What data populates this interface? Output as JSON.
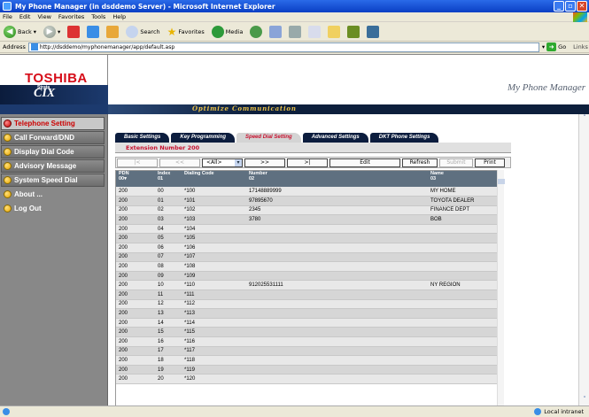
{
  "window": {
    "title": "My Phone Manager (in dsddemo Server) - Microsoft Internet Explorer",
    "menu": [
      "File",
      "Edit",
      "View",
      "Favorites",
      "Tools",
      "Help"
    ],
    "toolbar": {
      "back": "Back",
      "search": "Search",
      "favorites": "Favorites",
      "media": "Media"
    },
    "address_label": "Address",
    "address_url": "http://dsddemo/myphonemanager/app/default.asp",
    "go_label": "Go",
    "links_label": "Links",
    "status_zone": "Local intranet"
  },
  "header": {
    "brand": "TOSHIBA",
    "strata_label": "Strata",
    "cix_label": "CIX",
    "app_title": "My Phone Manager",
    "slogan": "Optimize Communication"
  },
  "sidebar": {
    "items": [
      {
        "label": "Telephone Setting",
        "active": true
      },
      {
        "label": "Call Forward/DND"
      },
      {
        "label": "Display Dial Code"
      },
      {
        "label": "Advisory Message"
      },
      {
        "label": "System Speed Dial"
      },
      {
        "label": "About ..."
      },
      {
        "label": "Log Out"
      }
    ]
  },
  "tabs": [
    "Basic Settings",
    "Key Programming",
    "Speed Dial Setting",
    "Advanced Settings",
    "DKT Phone Settings"
  ],
  "active_tab": "Speed Dial Setting",
  "extension_label": "Extension Number 200",
  "controls": {
    "first": "|<",
    "prev": "<<",
    "select_value": "<All>",
    "next": ">>",
    "last": ">|",
    "edit": "Edit",
    "refresh": "Refresh",
    "submit": "Submit",
    "print": "Print"
  },
  "table": {
    "columns": [
      {
        "label": "PDN",
        "sub": "00▾"
      },
      {
        "label": "Index",
        "sub": "01"
      },
      {
        "label": "Dialing Code",
        "sub": ""
      },
      {
        "label": "Number",
        "sub": "02"
      },
      {
        "label": "Name",
        "sub": "03"
      }
    ],
    "rows": [
      [
        "200",
        "00",
        "*100",
        "17148889999",
        "MY HOME"
      ],
      [
        "200",
        "01",
        "*101",
        "97895670",
        "TOYOTA DEALER"
      ],
      [
        "200",
        "02",
        "*102",
        "2345",
        "FINANCE DEPT"
      ],
      [
        "200",
        "03",
        "*103",
        "3780",
        "BOB"
      ],
      [
        "200",
        "04",
        "*104",
        "",
        ""
      ],
      [
        "200",
        "05",
        "*105",
        "",
        ""
      ],
      [
        "200",
        "06",
        "*106",
        "",
        ""
      ],
      [
        "200",
        "07",
        "*107",
        "",
        ""
      ],
      [
        "200",
        "08",
        "*108",
        "",
        ""
      ],
      [
        "200",
        "09",
        "*109",
        "",
        ""
      ],
      [
        "200",
        "10",
        "*110",
        "912025531111",
        "NY REGION"
      ],
      [
        "200",
        "11",
        "*111",
        "",
        ""
      ],
      [
        "200",
        "12",
        "*112",
        "",
        ""
      ],
      [
        "200",
        "13",
        "*113",
        "",
        ""
      ],
      [
        "200",
        "14",
        "*114",
        "",
        ""
      ],
      [
        "200",
        "15",
        "*115",
        "",
        ""
      ],
      [
        "200",
        "16",
        "*116",
        "",
        ""
      ],
      [
        "200",
        "17",
        "*117",
        "",
        ""
      ],
      [
        "200",
        "18",
        "*118",
        "",
        ""
      ],
      [
        "200",
        "19",
        "*119",
        "",
        ""
      ],
      [
        "200",
        "20",
        "*120",
        "",
        ""
      ]
    ]
  }
}
